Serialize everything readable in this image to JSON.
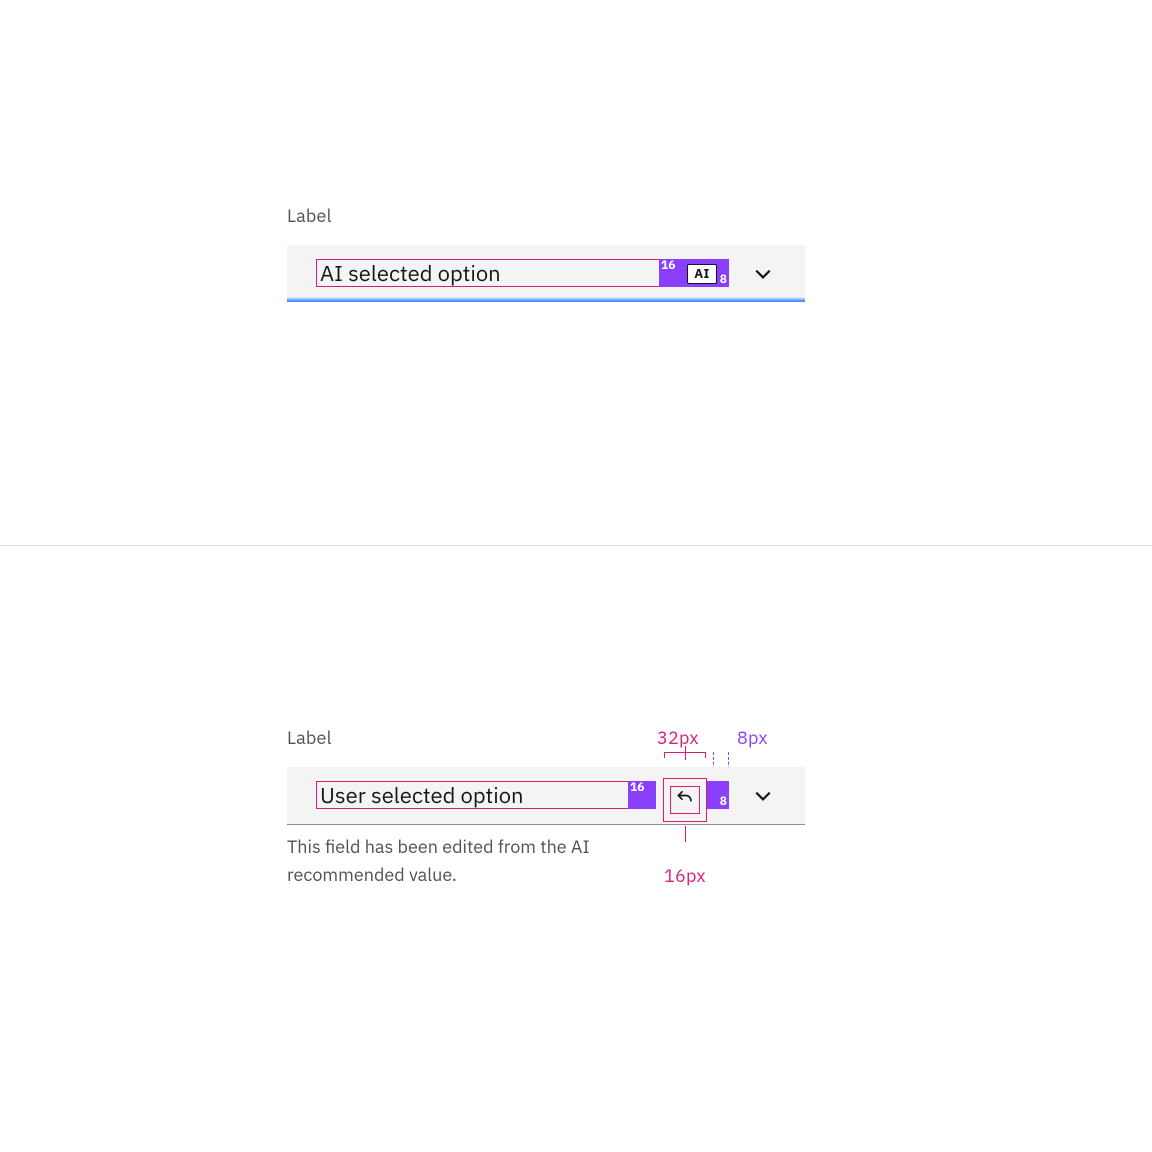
{
  "top": {
    "label": "Label",
    "value": "AI selected option",
    "seg16": "16",
    "seg8": "8",
    "ai_tag": "AI"
  },
  "bottom": {
    "label": "Label",
    "value": "User selected option",
    "seg16": "16",
    "seg8": "8",
    "helper": "This field has been edited from the AI recommended value.",
    "dim_32": "32px",
    "dim_8": "8px",
    "dim_16": "16px"
  }
}
